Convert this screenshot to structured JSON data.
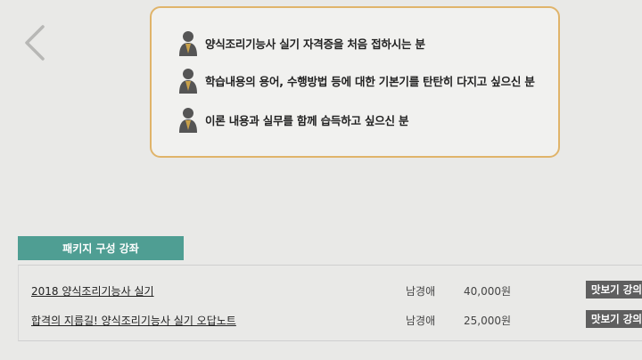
{
  "targets": [
    {
      "icon": "person-icon",
      "text": "양식조리기능사 실기 자격증을 처음 접하시는 분"
    },
    {
      "icon": "person-icon",
      "text": "학습내용의 용어, 수행방법 등에 대한 기본기를 탄탄히 다지고 싶으신 분"
    },
    {
      "icon": "person-icon",
      "text": "이론 내용과 실무를 함께 습득하고 싶으신 분"
    }
  ],
  "package": {
    "tab_label": "패키지 구성 강좌",
    "rows": [
      {
        "course": "2018 양식조리기능사 실기",
        "teacher": "남경애",
        "price": "40,000원",
        "preview": "맛보기 강의"
      },
      {
        "course": "합격의 지름길! 양식조리기능사 실기 오답노트",
        "teacher": "남경애",
        "price": "25,000원",
        "preview": "맛보기 강의"
      }
    ]
  },
  "colors": {
    "accent_border": "#e0b46a",
    "tab_bg": "#4f9e93",
    "preview_bg": "#5f5f5f"
  }
}
